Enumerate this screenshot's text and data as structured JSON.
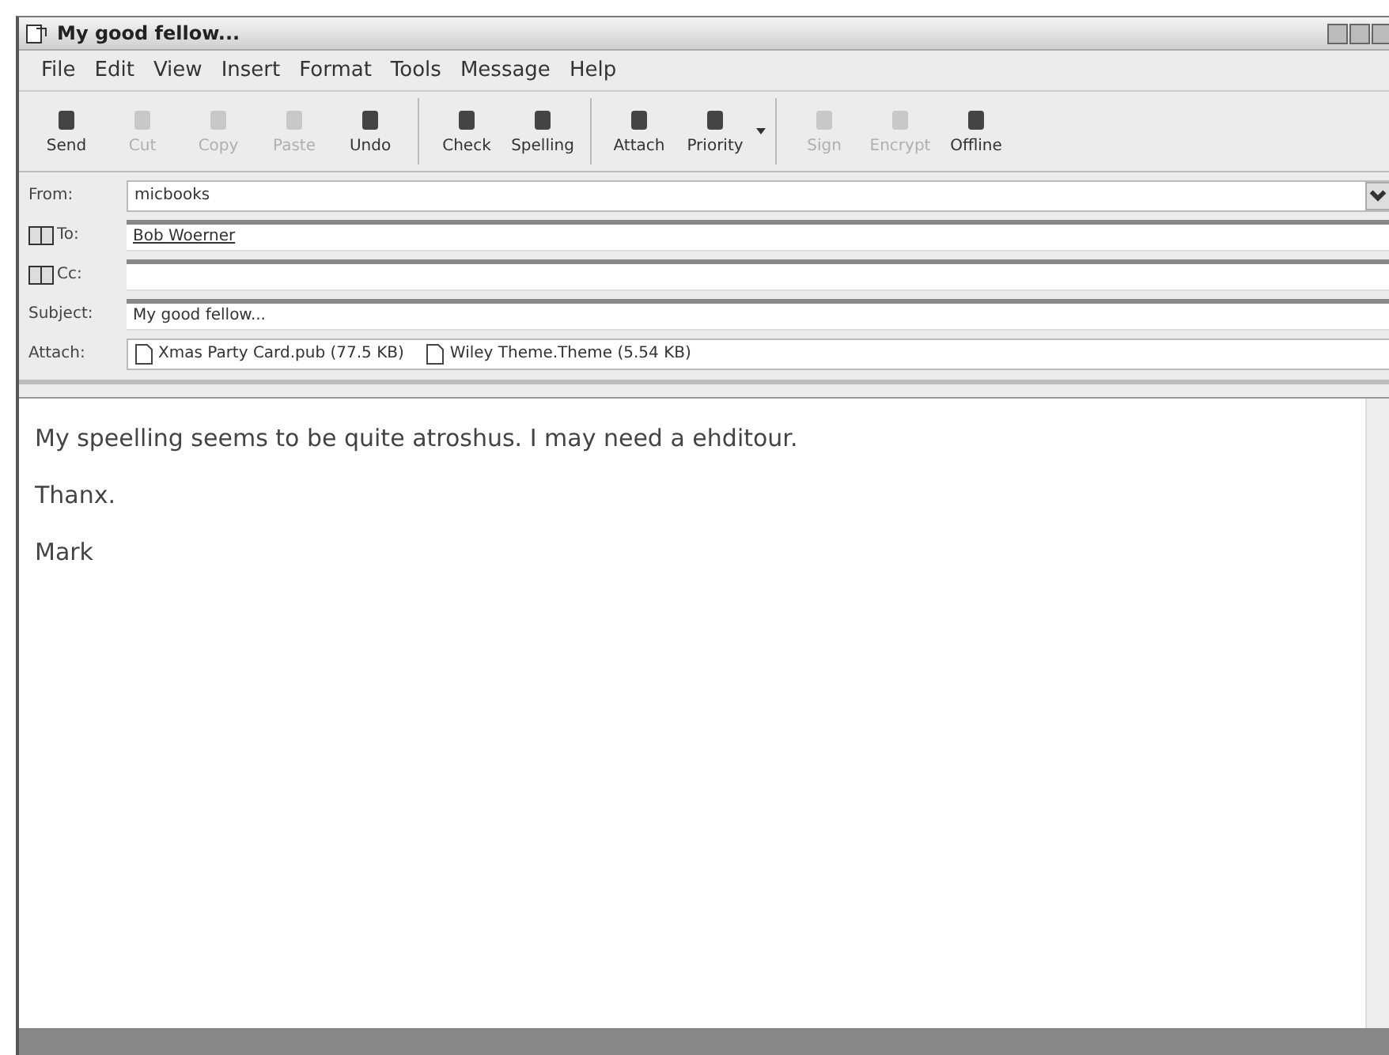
{
  "window": {
    "title": "My good fellow..."
  },
  "menu": [
    {
      "label": "File"
    },
    {
      "label": "Edit"
    },
    {
      "label": "View"
    },
    {
      "label": "Insert"
    },
    {
      "label": "Format"
    },
    {
      "label": "Tools"
    },
    {
      "label": "Message"
    },
    {
      "label": "Help"
    }
  ],
  "toolbar": {
    "groups": [
      [
        {
          "label": "Send",
          "disabled": false
        },
        {
          "label": "Cut",
          "disabled": true
        },
        {
          "label": "Copy",
          "disabled": true
        },
        {
          "label": "Paste",
          "disabled": true
        },
        {
          "label": "Undo",
          "disabled": false
        }
      ],
      [
        {
          "label": "Check",
          "disabled": false
        },
        {
          "label": "Spelling",
          "disabled": false
        }
      ],
      [
        {
          "label": "Attach",
          "disabled": false
        },
        {
          "label": "Priority",
          "disabled": false,
          "dropdown": true
        }
      ],
      [
        {
          "label": "Sign",
          "disabled": true
        },
        {
          "label": "Encrypt",
          "disabled": true
        },
        {
          "label": "Offline",
          "disabled": false
        }
      ]
    ]
  },
  "header": {
    "from": {
      "label": "From:",
      "value": "micbooks"
    },
    "to": {
      "label": "To:",
      "value": "Bob Woerner"
    },
    "cc": {
      "label": "Cc:"
    },
    "subject": {
      "label": "Subject:",
      "value": "My good fellow..."
    },
    "attach": {
      "label": "Attach:",
      "files": [
        "Xmas Party Card.pub (77.5 KB)",
        "Wiley Theme.Theme (5.54 KB)"
      ]
    }
  },
  "body": {
    "paragraphs": [
      "My speelling seems to be quite atroshus. I may need a ehditour.",
      "Thanx.",
      "Mark"
    ]
  }
}
